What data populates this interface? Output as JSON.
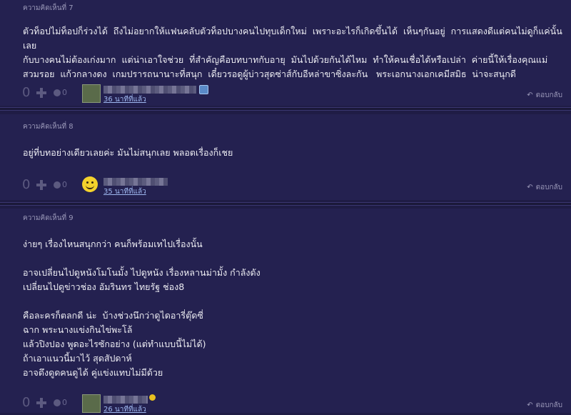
{
  "comments": [
    {
      "label": "ความคิดเห็นที่ 7",
      "body": "ตัวท็อปไม่ท็อปก็ร่วงได้  ถึงไม่อยากให้แฟนคลับตัวท็อปบางคนไปทุบเด็กใหม่  เพราะอะไรก็เกิดขึ้นได้  เห็นๆกันอยู่  การแสดงดีแต่คนไม่ดูก็แค่นั้นเลย\nกับบางคนไม่ต้องเก่งมาก  แต่น่าเอาใจช่วย  ที่สำคัญคือบทบาทกับอายุ  มันไปด้วยกันได้ไหม  ทำให้คนเชื่อได้หรือเปล่า  ค่ายนี้ให้เรื่องคุณแม่\nสวมรอย  แก้วกลางดง  เกมปรารถนานาะที่สนุก  เดี๋ยวรอดูผู้บ่าวสุดซ่าส์กับอีหล่าขาซิ่งละกัน   พระเอกนางเอกเคมีสมิธ  น่าจะสนุกดี",
      "votes": "0",
      "emo_count": "0",
      "time": "36 นาทีที่แล้ว",
      "reply": "ตอบกลับ"
    },
    {
      "label": "ความคิดเห็นที่ 8",
      "body": "อยู่ที่บทอย่างเดียวเลยค่ะ มันไม่สนุกเลย พลอตเรื่องก็เชย",
      "votes": "0",
      "emo_count": "0",
      "time": "35 นาทีที่แล้ว",
      "reply": "ตอบกลับ"
    },
    {
      "label": "ความคิดเห็นที่ 9",
      "body": "ง่ายๆ เรื่องไหนสนุกกว่า คนก็พร้อมเทไปเรื่องนั้น\n\nอาจเปลี่ยนไปดูหนังโมโนมั้ง ไปดูหนัง เรื่องหลานม่ามั้ง กำลังดัง\nเปลี่ยนไปดูข่าวช่อง อัมรินทร ไทยรัฐ ช่อง8\n\nคือละครก็ตลกดี น่ะ  บ้างช่วงนึกว่าดูไดอารี่ตุ๊ดซี่\nฉาก พระนางแข่งกินไข่พะโล้\nแล้วปิงปอง พูดอะไรซักอย่าง (แต่ทำแบบนี้ไม่ได้)\nถ้าเอาแนวนี้มาไว้ สุดสัปดาห์\nอาจดึงดูดคนดูได้ คู่แข่งแทบไม่มีด้วย",
      "votes": "0",
      "emo_count": "0",
      "time": "26 นาทีที่แล้ว",
      "reply": "ตอบกลับ"
    }
  ],
  "colors": {
    "background": "#1f1c45",
    "panel": "#242150",
    "link": "#9fb8f0",
    "muted": "#9a98b8"
  },
  "icons": [
    "plus-icon",
    "emotion-icon",
    "avatar-icon",
    "reply-arrow-icon",
    "badge-icon"
  ]
}
